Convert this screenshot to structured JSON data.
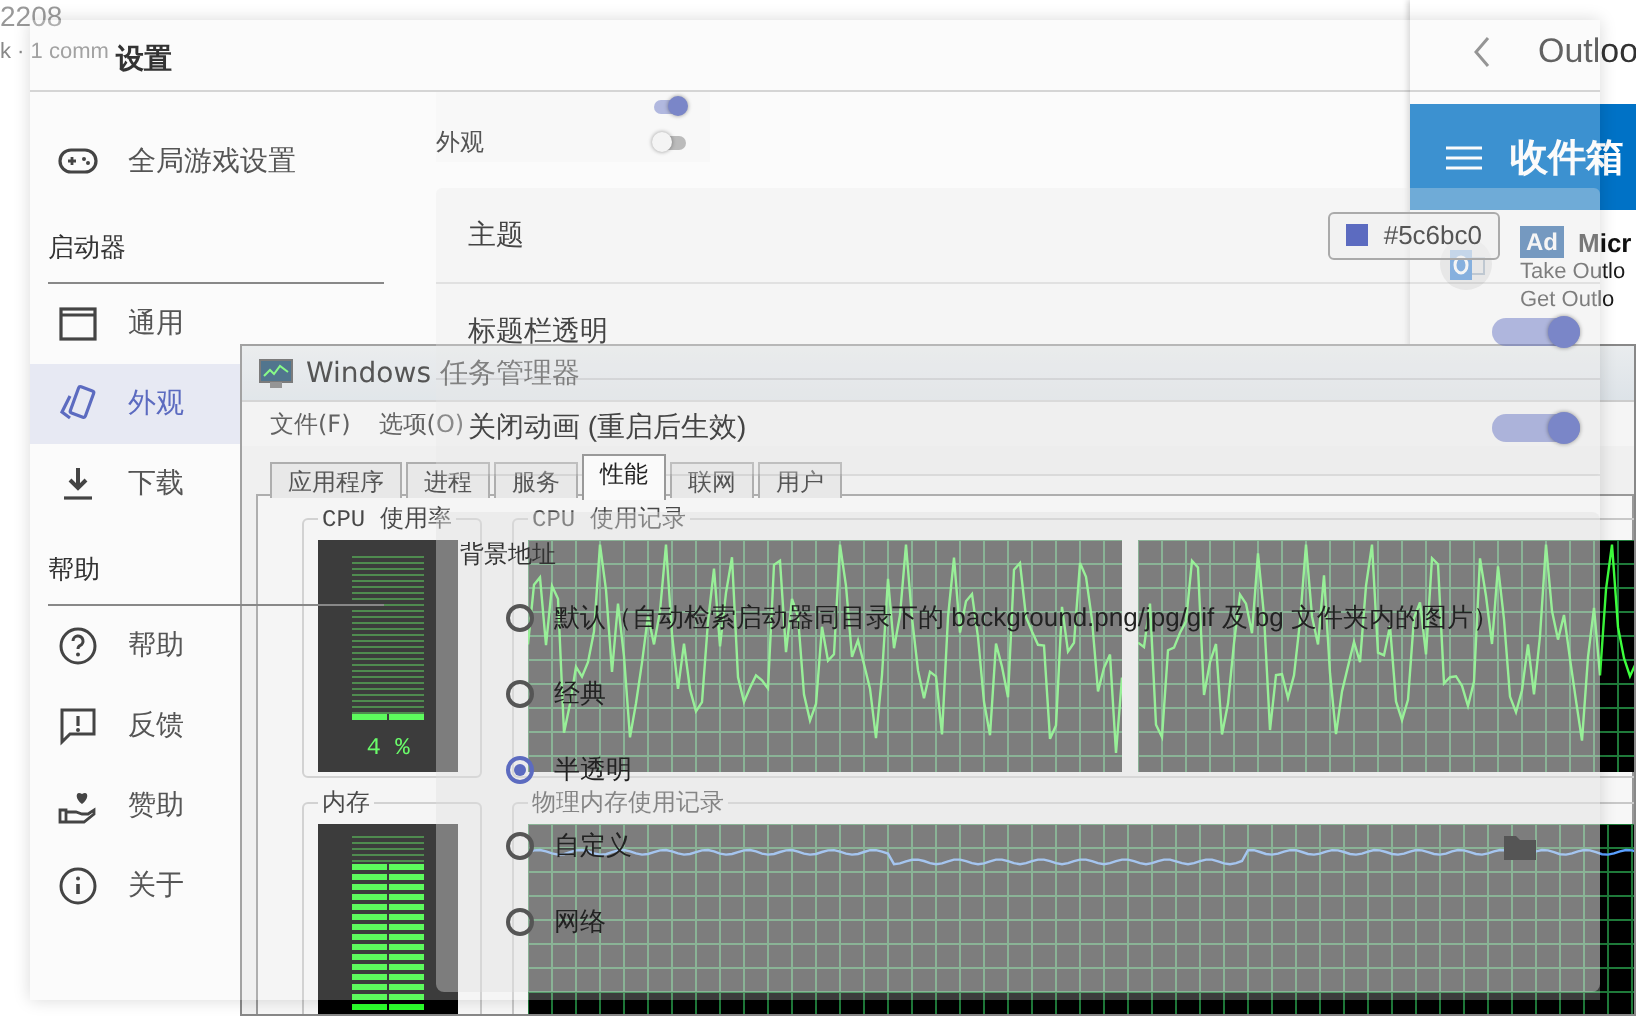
{
  "desktop": {
    "lines": [
      "2208",
      "k · 1 comm"
    ]
  },
  "outlook": {
    "title": "Outloo",
    "folder": "收件箱",
    "message": {
      "badge": "Ad",
      "sender": "Micr",
      "lines": [
        "Take Outlo",
        "Get Outlo"
      ]
    }
  },
  "task_manager": {
    "title": "Windows 任务管理器",
    "menu": [
      "文件(F)",
      "选项(O)"
    ],
    "tabs": [
      {
        "label": "应用程序",
        "selected": false
      },
      {
        "label": "进程",
        "selected": false
      },
      {
        "label": "服务",
        "selected": false
      },
      {
        "label": "性能",
        "selected": true
      },
      {
        "label": "联网",
        "selected": false
      },
      {
        "label": "用户",
        "selected": false
      }
    ],
    "cpu_usage": {
      "label": "CPU 使用率",
      "level": 0.04,
      "reading": "4 %"
    },
    "cpu_history": {
      "label": "CPU 使用记录"
    },
    "memory": {
      "label": "内存",
      "level": 0.87
    },
    "memory_history": {
      "label": "物理内存使用记录"
    }
  },
  "settings": {
    "title": "设置",
    "nav": [
      {
        "kind": "item",
        "label": "全局游戏设置",
        "selected": false
      },
      {
        "kind": "header",
        "label": "启动器"
      },
      {
        "kind": "item",
        "label": "通用",
        "selected": false
      },
      {
        "kind": "item",
        "label": "外观",
        "selected": true
      },
      {
        "kind": "item",
        "label": "下载",
        "selected": false
      },
      {
        "kind": "header",
        "label": "帮助"
      },
      {
        "kind": "item",
        "label": "帮助",
        "selected": false
      },
      {
        "kind": "item",
        "label": "反馈",
        "selected": false
      },
      {
        "kind": "item",
        "label": "赞助",
        "selected": false
      },
      {
        "kind": "item",
        "label": "关于",
        "selected": false
      }
    ],
    "top_card": [
      {
        "on": true
      },
      {
        "label": "外观",
        "on": false
      }
    ],
    "appearance": [
      {
        "kind": "color",
        "label": "主题",
        "value": "#5c6bc0"
      },
      {
        "kind": "switch",
        "label": "标题栏透明",
        "on": true
      },
      {
        "kind": "switch",
        "label": "关闭动画 (重启后生效)",
        "on": true
      }
    ],
    "background": {
      "title": "背景地址",
      "options": [
        {
          "kind": "plain",
          "label": "默认（自动检索启动器同目录下的 background.png/jpg/gif 及 bg 文件夹内的图片）",
          "selected": false
        },
        {
          "kind": "plain",
          "label": "经典",
          "selected": false
        },
        {
          "kind": "plain",
          "label": "半透明",
          "selected": true
        },
        {
          "kind": "browse",
          "label": "自定义",
          "selected": false
        },
        {
          "kind": "plain",
          "label": "网络",
          "selected": false
        }
      ]
    }
  }
}
